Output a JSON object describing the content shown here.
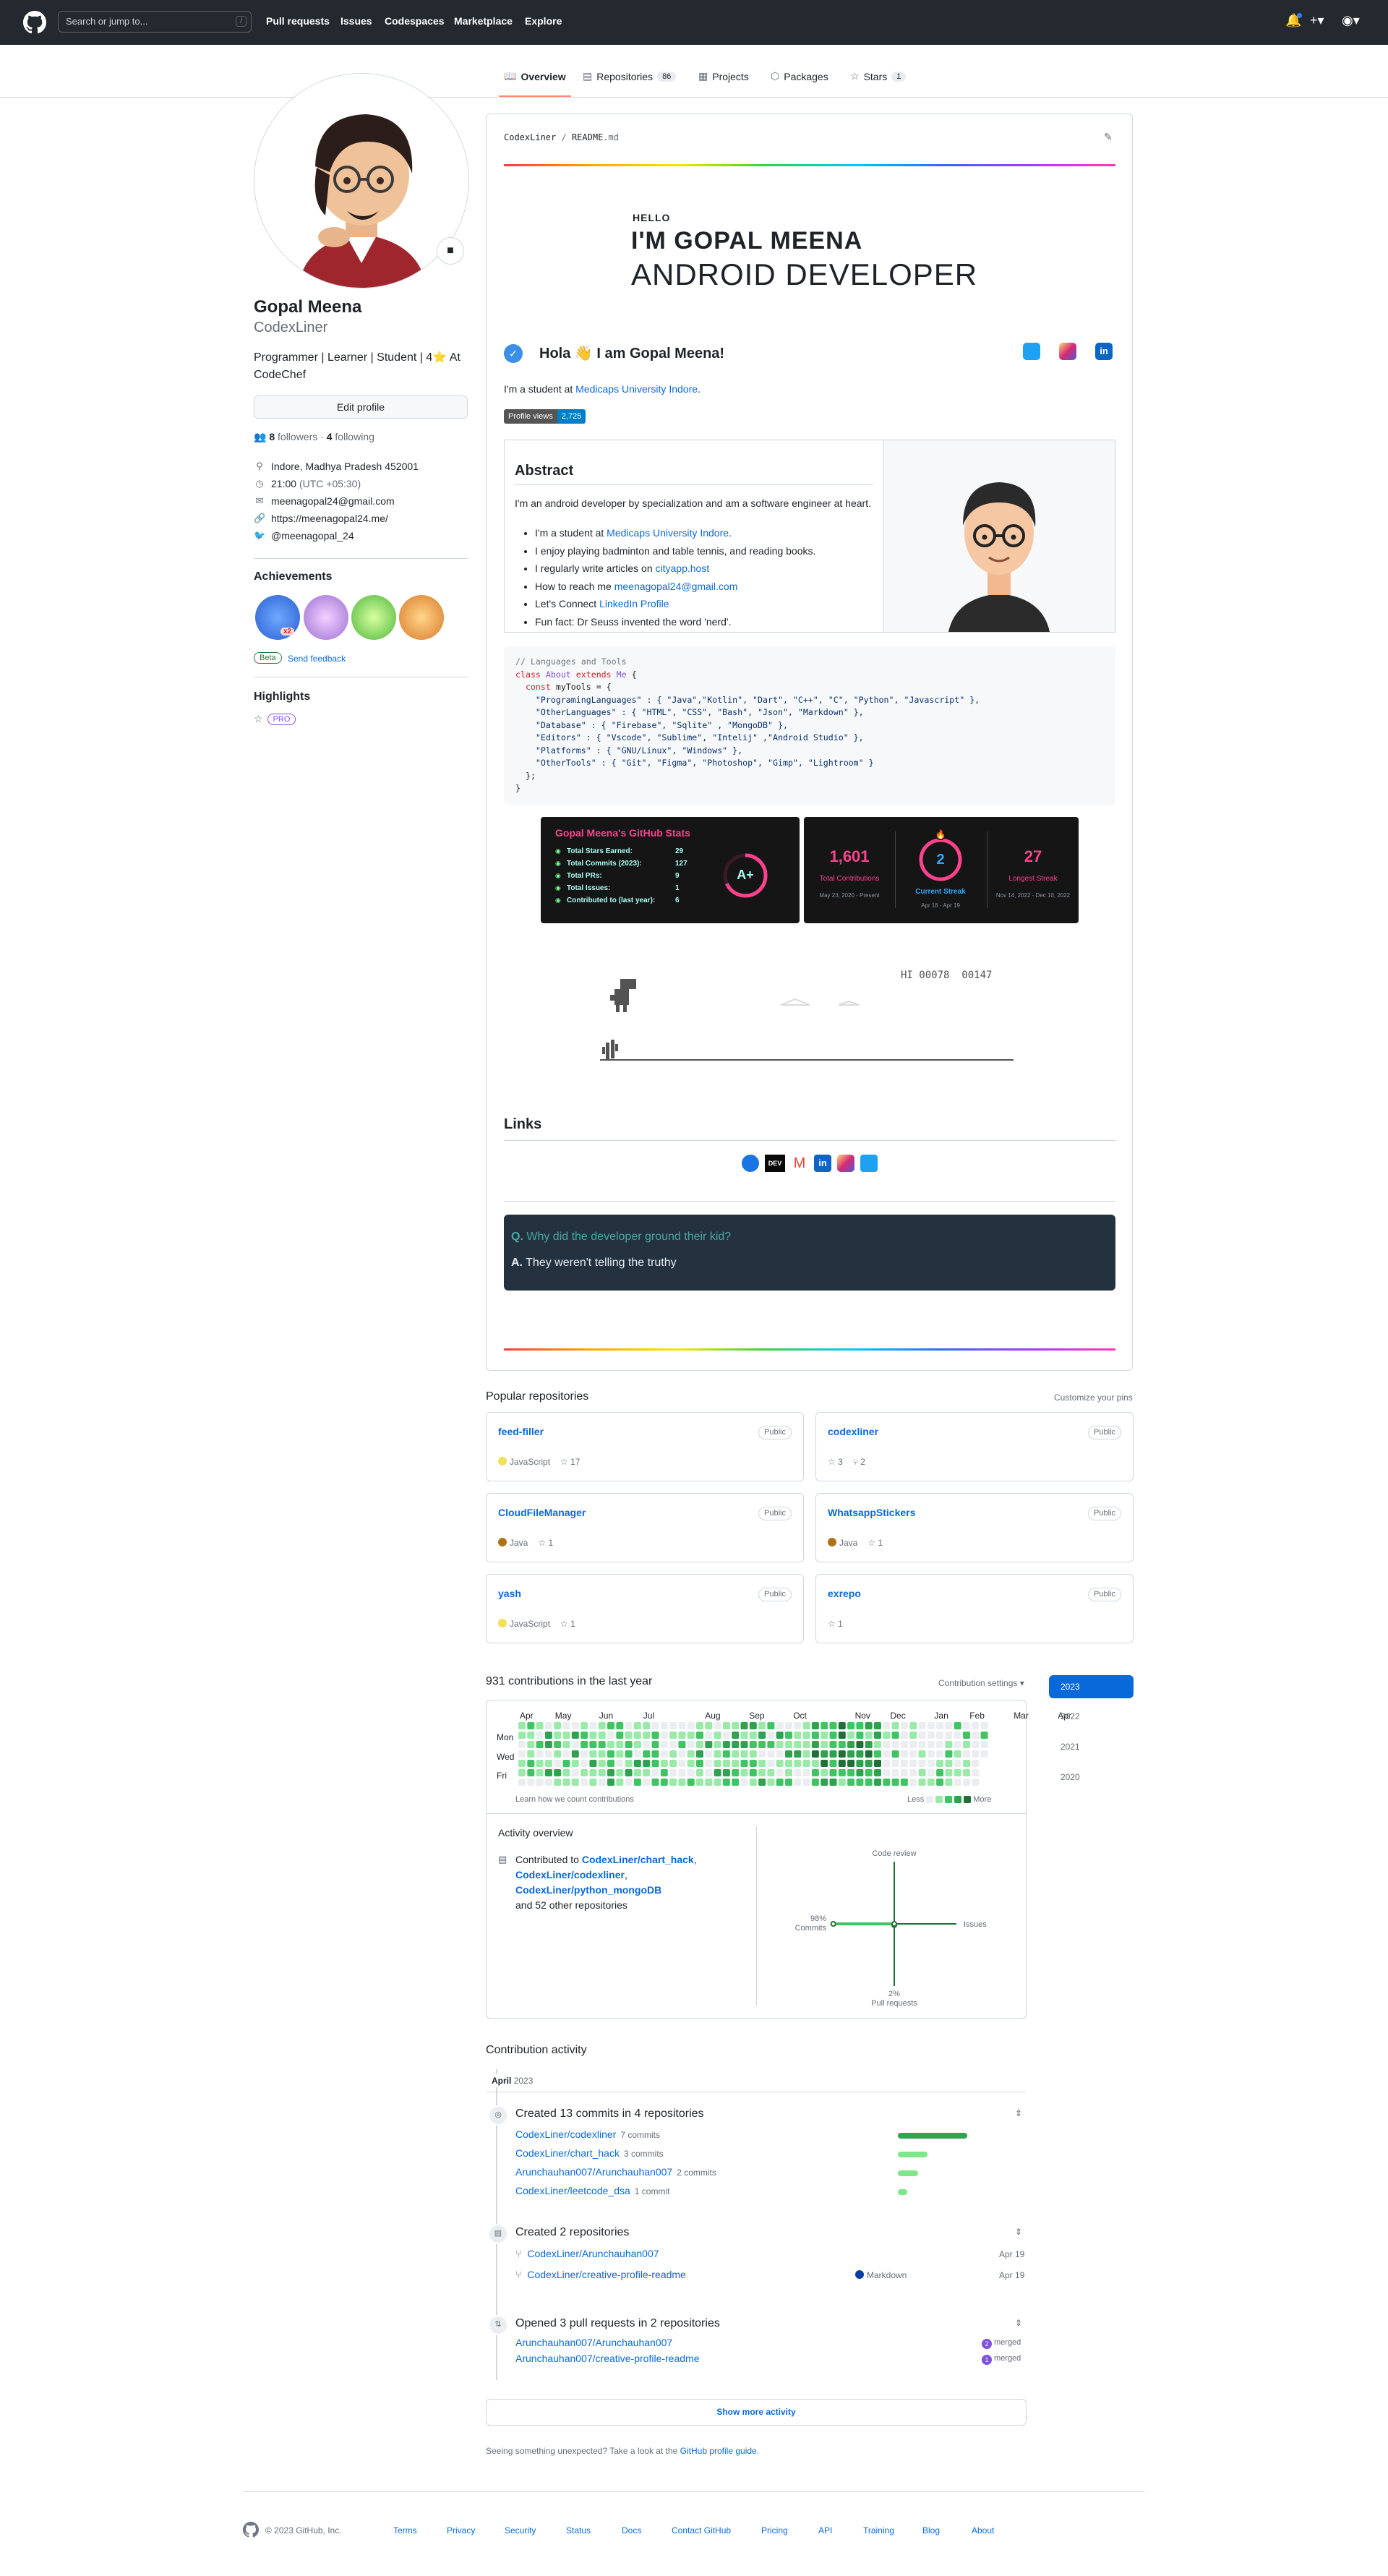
{
  "header": {
    "search_placeholder": "Search or jump to...",
    "search_shortcut": "/",
    "nav": [
      "Pull requests",
      "Issues",
      "Codespaces",
      "Marketplace",
      "Explore"
    ]
  },
  "tabs": {
    "overview": "Overview",
    "repositories": "Repositories",
    "repositories_count": "86",
    "projects": "Projects",
    "packages": "Packages",
    "stars": "Stars",
    "stars_count": "1"
  },
  "profile": {
    "fullname": "Gopal Meena",
    "username": "CodexLiner",
    "bio": "Programmer | Learner | Student | 4⭐ At CodeChef",
    "edit_button": "Edit profile",
    "followers_count": "8",
    "followers_label": "followers",
    "following_count": "4",
    "following_label": "following",
    "separator": "·",
    "location": "Indore, Madhya Pradesh 452001",
    "time": "21:00",
    "timezone": "(UTC +05:30)",
    "email": "meenagopal24@gmail.com",
    "website": "https://meenagopal24.me/",
    "twitter": "@meenagopal_24",
    "achievements_title": "Achievements",
    "achievement_multiplier": "x2",
    "beta_label": "Beta",
    "send_feedback": "Send feedback",
    "highlights_title": "Highlights",
    "pro_label": "PRO"
  },
  "readme": {
    "path_user": "CodexLiner",
    "path_sep": "/",
    "path_file": "README",
    "path_ext": ".md",
    "banner_hello": "HELLO",
    "banner_name": "I'M GOPAL MEENA",
    "banner_role": "ANDROID DEVELOPER",
    "greeting_pre": "Hola",
    "greeting_emoji": "👋",
    "greeting_post": "I am Gopal Meena!",
    "student_pre": "I'm a student at",
    "student_link": "Medicaps University Indore",
    "student_post": ".",
    "profile_views_label": "Profile views",
    "profile_views_count": "2,725",
    "abstract_title": "Abstract",
    "abstract_text": "I'm an android developer by specialization and am a software engineer at heart.",
    "bullets": {
      "b1_pre": "I'm a student at",
      "b1_link": "Medicaps University Indore",
      "b1_post": ".",
      "b2": "I enjoy playing badminton and table tennis, and reading books.",
      "b3_pre": "I regularly write articles on",
      "b3_link": "cityapp.host",
      "b4_pre": "How to reach me",
      "b4_link": "meenagopal24@gmail.com",
      "b5_pre": "Let's Connect",
      "b5_link": "LinkedIn Profile",
      "b6": "Fun fact: Dr Seuss invented the word 'nerd'."
    },
    "code": {
      "comment": "// Languages and Tools",
      "kw_class": "class",
      "class_name": "About",
      "kw_extends": "extends",
      "parent": "Me",
      "brace_open": " {",
      "kw_const": "const",
      "const_line": " myTools = {",
      "line1": "    \"ProgramingLanguages\" : { \"Java\",\"Kotlin\", \"Dart\", \"C++\", \"C\", \"Python\", \"Javascript\" },",
      "line2": "    \"OtherLanguages\" : { \"HTML\", \"CSS\", \"Bash\", \"Json\", \"Markdown\" },",
      "line3": "    \"Database\" : { \"Firebase\", \"Sqlite\" , \"MongoDB\" },",
      "line4": "    \"Editors\" : { \"Vscode\", \"Sublime\", \"Intelij\" ,\"Android Studio\" },",
      "line5": "    \"Platforms\" : { \"GNU/Linux\", \"Windows\" },",
      "line6": "    \"OtherTools\" : { \"Git\", \"Figma\", \"Photoshop\", \"Gimp\", \"Lightroom\" }",
      "close1": "  };",
      "close2": "}"
    },
    "stats_card": {
      "title": "Gopal Meena's GitHub Stats",
      "rows": [
        {
          "label": "Total Stars Earned:",
          "value": "29"
        },
        {
          "label": "Total Commits (2023):",
          "value": "127"
        },
        {
          "label": "Total PRs:",
          "value": "9"
        },
        {
          "label": "Total Issues:",
          "value": "1"
        },
        {
          "label": "Contributed to (last year):",
          "value": "6"
        }
      ],
      "grade": "A+"
    },
    "streak_card": {
      "total": "1,601",
      "total_label": "Total Contributions",
      "total_range": "May 23, 2020 - Present",
      "current": "2",
      "current_label": "Current Streak",
      "current_range": "Apr 18 - Apr 19",
      "longest": "27",
      "longest_label": "Longest Streak",
      "longest_range": "Nov 14, 2022 - Dec 10, 2022"
    },
    "dino_score": "HI 00078  00147",
    "links_title": "Links",
    "qa_question_letter": "Q.",
    "qa_question": "Why did the developer ground their kid?",
    "qa_answer_letter": "A.",
    "qa_answer": "They weren't telling the truthy"
  },
  "repos": {
    "title": "Popular repositories",
    "customize": "Customize your pins",
    "public_label": "Public",
    "items": [
      {
        "name": "feed-filler",
        "lang": "JavaScript",
        "lang_color": "#f1e05a",
        "stars": "17",
        "forks": ""
      },
      {
        "name": "codexliner",
        "lang": "",
        "lang_color": "",
        "stars": "3",
        "forks": "2"
      },
      {
        "name": "CloudFileManager",
        "lang": "Java",
        "lang_color": "#b07219",
        "stars": "1",
        "forks": ""
      },
      {
        "name": "WhatsappStickers",
        "lang": "Java",
        "lang_color": "#b07219",
        "stars": "1",
        "forks": ""
      },
      {
        "name": "yash",
        "lang": "JavaScript",
        "lang_color": "#f1e05a",
        "stars": "1",
        "forks": ""
      },
      {
        "name": "exrepo",
        "lang": "",
        "lang_color": "",
        "stars": "1",
        "forks": ""
      }
    ]
  },
  "contributions": {
    "title": "931 contributions in the last year",
    "settings": "Contribution settings ▾",
    "months": [
      "Apr",
      "May",
      "Jun",
      "Jul",
      "Aug",
      "Sep",
      "Oct",
      "Nov",
      "Dec",
      "Jan",
      "Feb",
      "Mar",
      "Apr"
    ],
    "days": [
      "Mon",
      "Wed",
      "Fri"
    ],
    "learn": "Learn how we count contributions",
    "less": "Less",
    "more": "More",
    "years": [
      "2023",
      "2022",
      "2021",
      "2020"
    ],
    "activity_title": "Activity overview",
    "contributed_pre": "Contributed to",
    "contributed_repos": [
      "CodexLiner/chart_hack",
      "CodexLiner/codexliner",
      "CodexLiner/python_mongoDB"
    ],
    "contributed_post": "and 52 other repositories",
    "axis": {
      "top": "Code review",
      "right": "Issues",
      "bottom_pct": "2%",
      "bottom": "Pull requests",
      "left_pct": "98%",
      "left": "Commits"
    },
    "axis_values": {
      "commits": 98,
      "pull_requests": 2,
      "issues": 0,
      "code_review": 0
    }
  },
  "activity": {
    "title": "Contribution activity",
    "month": "April",
    "year": "2023",
    "commits_header": "Created 13 commits in 4 repositories",
    "commit_rows": [
      {
        "repo": "CodexLiner/codexliner",
        "count": "7 commits",
        "fraction": 1.0
      },
      {
        "repo": "CodexLiner/chart_hack",
        "count": "3 commits",
        "fraction": 0.43
      },
      {
        "repo": "Arunchauhan007/Arunchauhan007",
        "count": "2 commits",
        "fraction": 0.29
      },
      {
        "repo": "CodexLiner/leetcode_dsa",
        "count": "1 commit",
        "fraction": 0.14
      }
    ],
    "repos_header": "Created 2 repositories",
    "repo_rows": [
      {
        "repo": "CodexLiner/Arunchauhan007",
        "lang": "",
        "date": "Apr 19"
      },
      {
        "repo": "CodexLiner/creative-profile-readme",
        "lang": "Markdown",
        "date": "Apr 19"
      }
    ],
    "pr_header": "Opened 3 pull requests in 2 repositories",
    "pr_rows": [
      {
        "repo": "Arunchauhan007/Arunchauhan007",
        "count": "2",
        "status": "merged"
      },
      {
        "repo": "Arunchauhan007/creative-profile-readme",
        "count": "1",
        "status": "merged"
      }
    ],
    "show_more": "Show more activity",
    "unexpected_pre": "Seeing something unexpected? Take a look at the",
    "unexpected_link": "GitHub profile guide",
    "unexpected_post": "."
  },
  "footer": {
    "copyright": "© 2023 GitHub, Inc.",
    "links": [
      "Terms",
      "Privacy",
      "Security",
      "Status",
      "Docs",
      "Contact GitHub",
      "Pricing",
      "API",
      "Training",
      "Blog",
      "About"
    ]
  },
  "colors": {
    "header_bg": "#24292f",
    "link": "#0969da",
    "tab_active": "#fd8c73",
    "contrib_levels": [
      "#ebedf0",
      "#9be9a8",
      "#40c463",
      "#30a14e",
      "#216e39"
    ],
    "stats_title": "#fe428e",
    "streak_accent": "#fe428e"
  }
}
